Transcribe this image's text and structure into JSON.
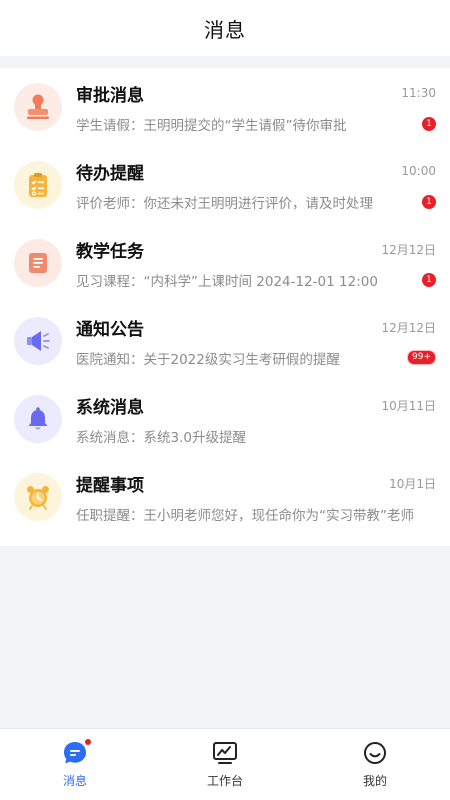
{
  "header": {
    "title": "消息"
  },
  "messages": [
    {
      "name": "审批消息",
      "time": "11:30",
      "preview": "学生请假：王明明提交的“学生请假”待你审批",
      "badge": "1",
      "icon": "stamp-icon"
    },
    {
      "name": "待办提醒",
      "time": "10:00",
      "preview": "评价老师：你还未对王明明进行评价，请及时处理",
      "badge": "1",
      "icon": "clipboard-icon"
    },
    {
      "name": "教学任务",
      "time": "12月12日",
      "preview": "见习课程：“内科学”上课时间 2024-12-01 12:00",
      "badge": "1",
      "icon": "document-icon"
    },
    {
      "name": "通知公告",
      "time": "12月12日",
      "preview": "医院通知：关于2022级实习生考研假的提醒",
      "badge": "99+",
      "icon": "megaphone-icon"
    },
    {
      "name": "系统消息",
      "time": "10月11日",
      "preview": "系统消息：系统3.0升级提醒",
      "badge": "",
      "icon": "bell-icon"
    },
    {
      "name": "提醒事项",
      "time": "10月1日",
      "preview": "任职提醒：王小明老师您好，现任命你为“实习带教”老师",
      "badge": "",
      "icon": "alarm-clock-icon"
    }
  ],
  "tabs": [
    {
      "label": "消息",
      "icon": "chat-icon",
      "active": true
    },
    {
      "label": "工作台",
      "icon": "workbench-icon",
      "active": false
    },
    {
      "label": "我的",
      "icon": "smile-icon",
      "active": false
    }
  ],
  "colors": {
    "accent": "#2f6cf6",
    "badge": "#e8202a"
  }
}
